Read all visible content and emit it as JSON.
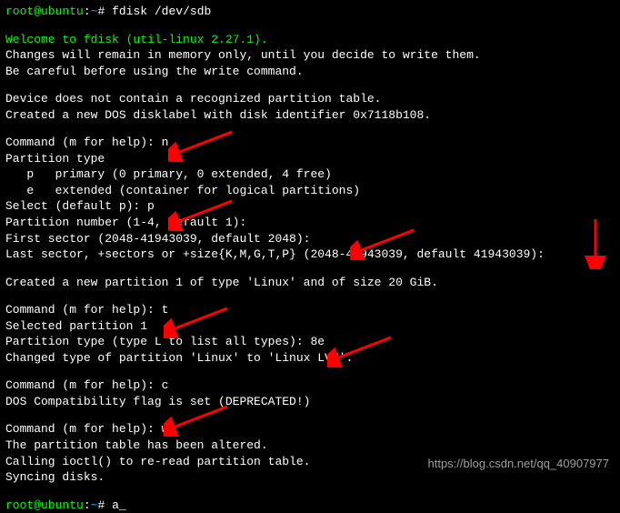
{
  "prompt": {
    "user": "root@ubuntu",
    "colon": ":",
    "path": "~",
    "hash": "#"
  },
  "cmd1": "fdisk /dev/sdb",
  "welcome": "Welcome to fdisk (util-linux 2.27.1).",
  "l1": "Changes will remain in memory only, until you decide to write them.",
  "l2": "Be careful before using the write command.",
  "l3": "Device does not contain a recognized partition table.",
  "l4": "Created a new DOS disklabel with disk identifier 0x7118b108.",
  "cmd_prompt": "Command (m for help): ",
  "input_n": "n",
  "l5": "Partition type",
  "l6": "   p   primary (0 primary, 0 extended, 4 free)",
  "l7": "   e   extended (container for logical partitions)",
  "select_prompt": "Select (default p): ",
  "input_p": "p",
  "l8": "Partition number (1-4, default 1):",
  "l9": "First sector (2048-41943039, default 2048):",
  "l10": "Last sector, +sectors or +size{K,M,G,T,P} (2048-41943039, default 41943039):",
  "l11": "Created a new partition 1 of type 'Linux' and of size 20 GiB.",
  "input_t": "t",
  "l12": "Selected partition 1",
  "ptype_prompt": "Partition type (type L to list all types): ",
  "input_8e": "8e",
  "l13": "Changed type of partition 'Linux' to 'Linux LVM'.",
  "input_c": "c",
  "l14": "DOS Compatibility flag is set (DEPRECATED!)",
  "input_w": "w",
  "l15": "The partition table has been altered.",
  "l16": "Calling ioctl() to re-read partition table.",
  "l17": "Syncing disks.",
  "cmd2": "a",
  "cursor": "_",
  "watermark": "https://blog.csdn.net/qq_40907977",
  "arrows": {
    "color": "#ff0000"
  }
}
